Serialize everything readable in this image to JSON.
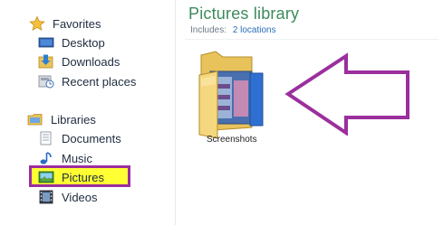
{
  "nav": {
    "favorites": {
      "label": "Favorites",
      "items": [
        {
          "label": "Desktop",
          "icon": "desktop-icon"
        },
        {
          "label": "Downloads",
          "icon": "downloads-icon"
        },
        {
          "label": "Recent places",
          "icon": "recent-places-icon"
        }
      ]
    },
    "libraries": {
      "label": "Libraries",
      "items": [
        {
          "label": "Documents",
          "icon": "documents-icon"
        },
        {
          "label": "Music",
          "icon": "music-icon"
        },
        {
          "label": "Pictures",
          "icon": "pictures-icon",
          "selected": true
        },
        {
          "label": "Videos",
          "icon": "videos-icon"
        }
      ]
    }
  },
  "library": {
    "title": "Pictures library",
    "includes_label": "Includes:",
    "locations_link": "2 locations"
  },
  "items": [
    {
      "label": "Screenshots",
      "icon": "folder-icon"
    }
  ],
  "colors": {
    "title_green": "#3c8a5c",
    "link_blue": "#2a6ebb",
    "highlight_yellow": "#ffff33",
    "annotation_purple": "#9b2f9e"
  }
}
